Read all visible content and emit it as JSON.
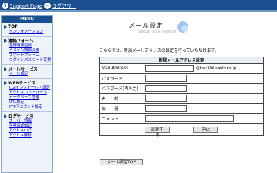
{
  "topbar": {
    "support_label": "Support Page",
    "logout_label": "ログアウト"
  },
  "sidebar": {
    "title": "MENU",
    "sections": [
      {
        "label": "TOP",
        "items": [
          "インフォメーション"
        ]
      },
      {
        "label": "連絡フォーム",
        "items": [
          "登録情報変更",
          "ドメイン情報変更",
          "サポートフォーム",
          "ログインパスワード変更"
        ]
      },
      {
        "label": "メールサービス",
        "items": [
          "メール設定"
        ]
      },
      {
        "label": "WEBサービス",
        "items": [
          "CGIインストール・設定",
          "アクセスコントロール",
          "データベース管理",
          "URL設定",
          "FTPアカウント設定"
        ]
      },
      {
        "label": "ログサービス",
        "items": [
          "サーバー情報",
          "容量確認設定",
          "アクセスログ",
          "アクセス解析"
        ]
      }
    ]
  },
  "header": {
    "title": "メール設定",
    "subtitle": "Setup mail setting"
  },
  "intro_text": "こちらでは、新規メールアドレスの設定を行っていただけます。",
  "form": {
    "title": "新規メールアドレス設定",
    "rows": [
      {
        "label": "Mail Address",
        "value": "",
        "domain": "@test306.saido.ne.jp"
      },
      {
        "label": "パスワード",
        "value": ""
      },
      {
        "label": "パスワード(再入力)",
        "value": ""
      },
      {
        "label": "名　　前",
        "value": ""
      },
      {
        "label": "部　　署",
        "value": ""
      },
      {
        "label": "コメント",
        "value": ""
      }
    ],
    "submit_label": "設定する",
    "cancel_label": "中止"
  },
  "back_button_label": "メール設定TOP"
}
